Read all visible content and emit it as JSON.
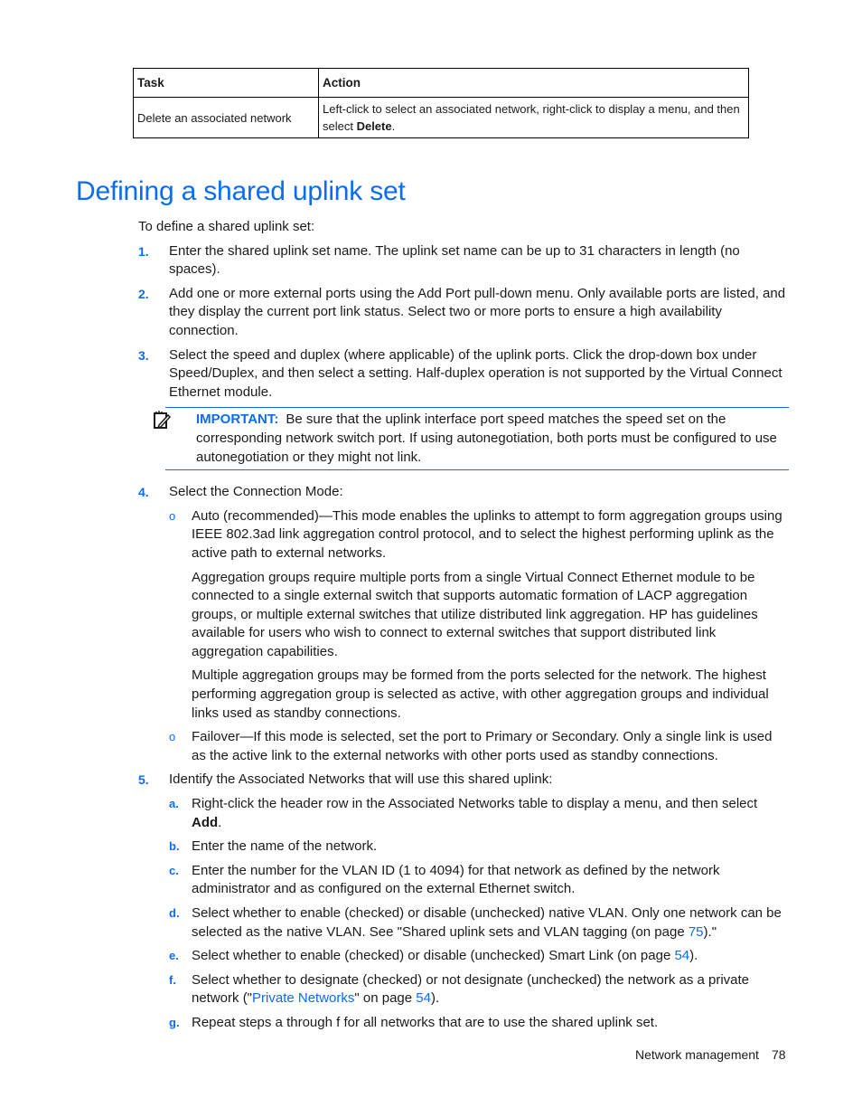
{
  "table": {
    "headers": [
      "Task",
      "Action"
    ],
    "rows": [
      {
        "task": "Delete an associated network",
        "action_pre": "Left-click to select an associated network, right-click to display a menu, and then select ",
        "action_bold": "Delete",
        "action_post": "."
      }
    ]
  },
  "section": {
    "title": "Defining a shared uplink set",
    "intro": "To define a shared uplink set:",
    "steps": {
      "s1": {
        "num": "1.",
        "text": "Enter the shared uplink set name. The uplink set name can be up to 31 characters in length (no spaces)."
      },
      "s2": {
        "num": "2.",
        "text": "Add one or more external ports using the Add Port pull-down menu. Only available ports are listed, and they display the current port link status. Select two or more ports to ensure a high availability connection."
      },
      "s3": {
        "num": "3.",
        "text": "Select the speed and duplex (where applicable) of the uplink ports. Click the drop-down box under Speed/Duplex, and then select a setting. Half-duplex operation is not supported by the Virtual Connect Ethernet module."
      },
      "note": {
        "icon": "important-note-icon",
        "label": "IMPORTANT:",
        "text": "Be sure that the uplink interface port speed matches the speed set on the corresponding network switch port. If using autonegotiation, both ports must be configured to use autonegotiation or they might not link."
      },
      "s4": {
        "num": "4.",
        "text": "Select the Connection Mode:",
        "bullet_glyph": "o",
        "auto": "Auto (recommended)—This mode enables the uplinks to attempt to form aggregation groups using IEEE 802.3ad link aggregation control protocol, and to select the highest performing uplink as the active path to external networks.",
        "auto_p2": "Aggregation groups require multiple ports from a single Virtual Connect Ethernet module to be connected to a single external switch that supports automatic formation of LACP aggregation groups, or multiple external switches that utilize distributed link aggregation. HP has guidelines available for users who wish to connect to external switches that support distributed link aggregation capabilities.",
        "auto_p3": "Multiple aggregation groups may be formed from the ports selected for the network. The highest performing aggregation group is selected as active, with other aggregation groups and individual links used as standby connections.",
        "failover": "Failover—If this mode is selected, set the port to Primary or Secondary. Only a single link is used as the active link to the external networks with other ports used as standby connections."
      },
      "s5": {
        "num": "5.",
        "text": "Identify the Associated Networks that will use this shared uplink:",
        "a": {
          "mk": "a.",
          "pre": "Right-click the header row in the Associated Networks table to display a menu, and then select ",
          "bold": "Add",
          "post": "."
        },
        "b": {
          "mk": "b.",
          "text": "Enter the name of the network."
        },
        "c": {
          "mk": "c.",
          "text": "Enter the number for the VLAN ID (1 to 4094) for that network as defined by the network administrator and as configured on the external Ethernet switch."
        },
        "d": {
          "mk": "d.",
          "pre": "Select whether to enable (checked) or disable (unchecked) native VLAN. Only one network can be selected as the native VLAN. See \"Shared uplink sets and VLAN tagging (on page ",
          "link": "75",
          "post": ").\""
        },
        "e": {
          "mk": "e.",
          "pre": "Select whether to enable (checked) or disable (unchecked) Smart Link (on page ",
          "link": "54",
          "post": ")."
        },
        "f": {
          "mk": "f.",
          "pre": "Select whether to designate (checked) or not designate (unchecked) the network as a private network (\"",
          "link1": "Private Networks",
          "mid": "\" on page ",
          "link2": "54",
          "post": ")."
        },
        "g": {
          "mk": "g.",
          "text": "Repeat steps a through f for all networks that are to use the shared uplink set."
        }
      }
    }
  },
  "footer": {
    "section": "Network management",
    "page": "78"
  },
  "colors": {
    "accent": "#0b6cf1",
    "text": "#1a1a1a"
  }
}
